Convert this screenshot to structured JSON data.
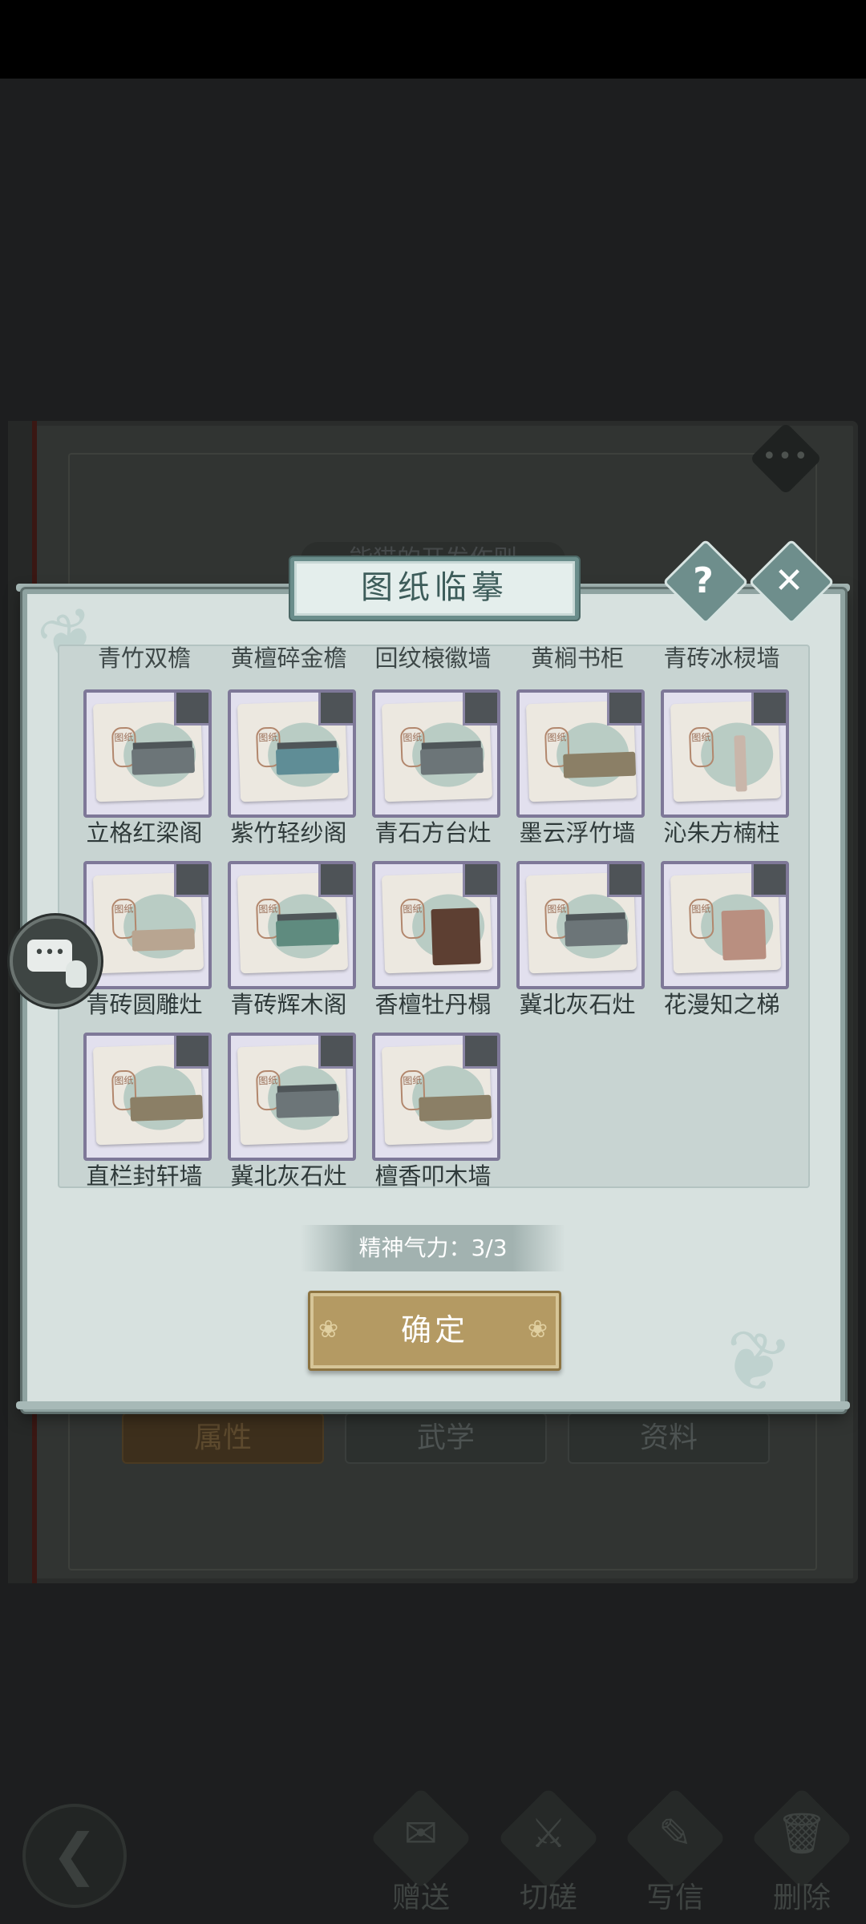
{
  "book": {
    "subtitle": "能猫的开发作则",
    "tabs": [
      {
        "label": "属性",
        "active": true
      },
      {
        "label": "武学",
        "active": false
      },
      {
        "label": "资料",
        "active": false
      }
    ],
    "more_icon": "more-dots-icon"
  },
  "bottom_bar": {
    "back_icon": "back-arrow-icon",
    "actions": [
      {
        "label": "赠送",
        "icon": "scroll-icon"
      },
      {
        "label": "切磋",
        "icon": "sword-icon"
      },
      {
        "label": "写信",
        "icon": "letter-icon"
      },
      {
        "label": "删除",
        "icon": "trash-icon"
      }
    ]
  },
  "dialog": {
    "title": "图纸临摹",
    "help_label": "?",
    "close_label": "✕",
    "partial_row": [
      "青竹双檐",
      "黄檀碎金檐",
      "回纹榱徽墙",
      "黄榈书柜",
      "青砖冰棂墙"
    ],
    "items": [
      {
        "name": "立格红梁阁",
        "model": "house"
      },
      {
        "name": "紫竹轻纱阁",
        "model": "glass"
      },
      {
        "name": "青石方台灶",
        "model": "stove"
      },
      {
        "name": "墨云浮竹墙",
        "model": "wall"
      },
      {
        "name": "沁朱方楠柱",
        "model": "pillar"
      },
      {
        "name": "青砖圆雕灶",
        "model": "tan"
      },
      {
        "name": "青砖辉木阁",
        "model": "green"
      },
      {
        "name": "香檀牡丹榻",
        "model": "bed"
      },
      {
        "name": "冀北灰石灶",
        "model": "stove"
      },
      {
        "name": "花漫知之梯",
        "model": "shelf"
      },
      {
        "name": "直栏封轩墙",
        "model": "wall"
      },
      {
        "name": "冀北灰石灶",
        "model": "stove"
      },
      {
        "name": "檀香叩木墙",
        "model": "wall"
      }
    ],
    "seal_text": "图纸",
    "stamina_text": "精神气力：3/3",
    "confirm_label": "确定"
  },
  "chat_button": {
    "icon": "chat-bubble-icon",
    "text": "•••"
  },
  "colors": {
    "dialog_bg": "#d7e1df",
    "frame": "#8fa3a1",
    "confirm_gold": "#b49a63",
    "tile_border": "#7e7898"
  }
}
